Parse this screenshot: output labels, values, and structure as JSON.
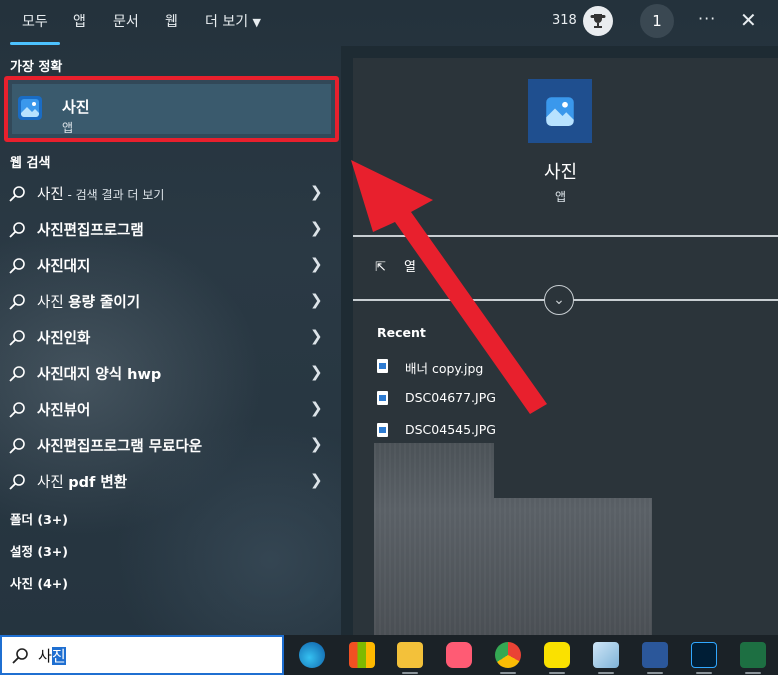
{
  "topbar": {
    "tabs": [
      "모두",
      "앱",
      "문서",
      "웹",
      "더 보기"
    ],
    "points": "318",
    "avatar_number": "1",
    "more_icon": "more-icon",
    "close_icon": "close-icon"
  },
  "left": {
    "best_match_title": "가장 정확",
    "best_match": {
      "name": "사진",
      "type": "앱"
    },
    "web_search_title": "웹 검색",
    "web_items": [
      {
        "prefix": "사진",
        "bold": "",
        "suffix": " - 검색 결과 더 보기"
      },
      {
        "prefix": "",
        "bold": "사진편집프로그램",
        "suffix": ""
      },
      {
        "prefix": "",
        "bold": "사진대지",
        "suffix": ""
      },
      {
        "prefix": "사진 ",
        "bold": "용량 줄이기",
        "suffix": ""
      },
      {
        "prefix": "",
        "bold": "사진인화",
        "suffix": ""
      },
      {
        "prefix": "",
        "bold": "사진대지 양식 hwp",
        "suffix": ""
      },
      {
        "prefix": "",
        "bold": "사진뷰어",
        "suffix": ""
      },
      {
        "prefix": "",
        "bold": "사진편집프로그램 무료다운",
        "suffix": ""
      },
      {
        "prefix": "사진 ",
        "bold": "pdf 변환",
        "suffix": ""
      }
    ],
    "categories": [
      "폴더 (3+)",
      "설정 (3+)",
      "사진 (4+)"
    ]
  },
  "right": {
    "app_name": "사진",
    "app_type": "앱",
    "open_label": "열",
    "recent_title": "Recent",
    "recent_files": [
      "배너 copy.jpg",
      "DSC04677.JPG",
      "DSC04545.JPG"
    ]
  },
  "taskbar": {
    "search_value_prefix": "사",
    "search_value_selected": "진",
    "apps": [
      "edge-icon",
      "app-store-icon",
      "file-explorer-icon",
      "camera-app-icon",
      "chrome-icon",
      "kakaotalk-icon",
      "notepad-icon",
      "word-icon",
      "photoshop-icon",
      "excel-icon"
    ]
  },
  "colors": {
    "accent": "#4cc2ff",
    "highlight_border": "#e8202d",
    "arrow": "#e8202d"
  }
}
